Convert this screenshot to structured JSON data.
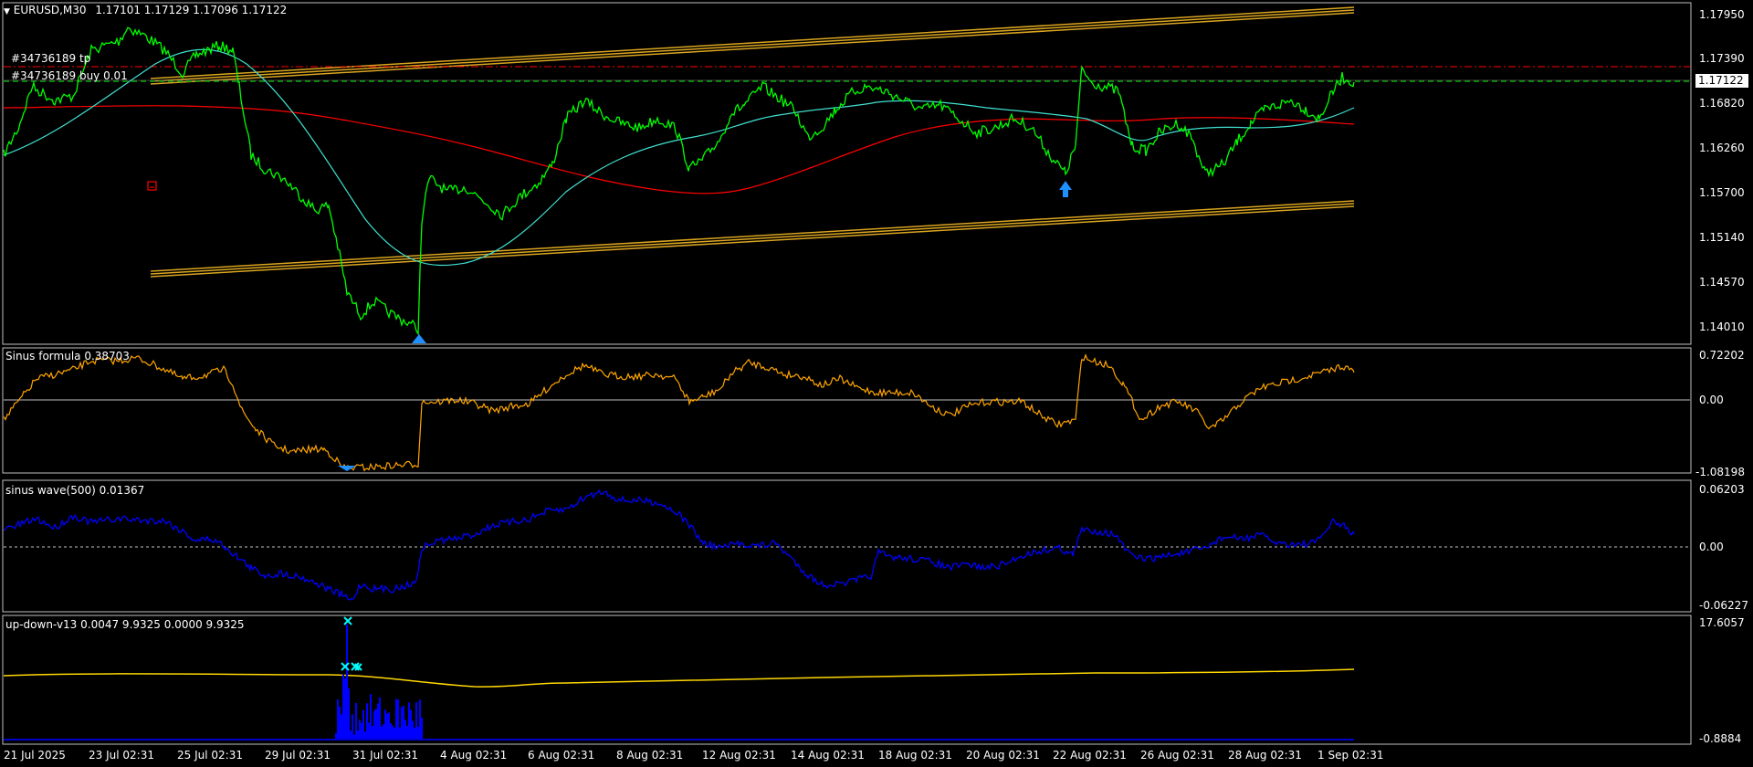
{
  "main": {
    "header_symbol": "EURUSD,M30",
    "header_ohlc": "1.17101 1.17129 1.17096 1.17122",
    "current_price": "1.17122",
    "order_tp": "#34736189 tp",
    "order_buy": "#34736189 buy 0.01",
    "price_axis": [
      "1.17950",
      "1.17390",
      "1.16820",
      "1.16260",
      "1.15700",
      "1.15140",
      "1.14570",
      "1.14010"
    ],
    "colors": {
      "price": "#00ff00",
      "fast_ma": "#40e0d0",
      "slow_ma": "#ff0000",
      "channel": "#daa520",
      "tp_line": "#ff0000",
      "order_line": "#00aa00",
      "arrow": "#1e90ff"
    }
  },
  "indicators": [
    {
      "id": "sinus_formula",
      "title": "Sinus formula 0.38703",
      "axis": [
        "0.72202",
        "0.00",
        "-1.08198"
      ],
      "color": "#ffa500"
    },
    {
      "id": "sinus_wave",
      "title": "sinus wave(500) 0.01367",
      "axis": [
        "0.06203",
        "0.00",
        "-0.06227"
      ],
      "color": "#0000ff"
    },
    {
      "id": "up_down",
      "title": "up-down-v13 0.0047 9.9325 0.0000 9.9325",
      "axis": [
        "17.6057",
        "-0.8884"
      ],
      "color_line": "#ffd700",
      "color_hist": "#0000ff",
      "color_marker": "#00ffff"
    }
  ],
  "time_axis": [
    "21 Jul 2025",
    "23 Jul 02:31",
    "25 Jul 02:31",
    "29 Jul 02:31",
    "31 Jul 02:31",
    "4 Aug 02:31",
    "6 Aug 02:31",
    "8 Aug 02:31",
    "12 Aug 02:31",
    "14 Aug 02:31",
    "18 Aug 02:31",
    "20 Aug 02:31",
    "22 Aug 02:31",
    "26 Aug 02:31",
    "28 Aug 02:31",
    "1 Sep 02:31"
  ]
}
